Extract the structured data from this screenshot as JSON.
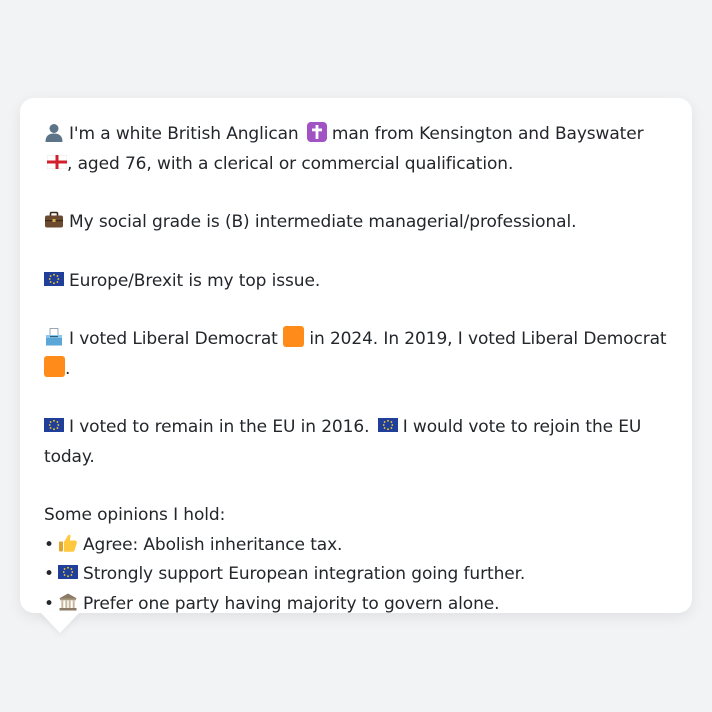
{
  "persona": {
    "identity": {
      "pre": "I'm a white British Anglican",
      "mid": "man from Kensington and Bayswater",
      "post": ", aged 76, with a clerical or commercial qualification."
    },
    "social_grade": "My social grade is (B) intermediate managerial/professional.",
    "top_issue": "Europe/Brexit is my top issue.",
    "votes": {
      "pre": "I voted Liberal Democrat",
      "mid": "in 2024. In 2019, I voted Liberal Democrat",
      "post": "."
    },
    "eu": {
      "first": "I voted to remain in the EU in 2016.",
      "second": "I would vote to rejoin the EU today."
    },
    "opinions_heading": "Some opinions I hold:",
    "opinions": [
      {
        "bullet": "•",
        "icon": "thumbs-up-icon",
        "text": "Agree: Abolish inheritance tax."
      },
      {
        "bullet": "•",
        "icon": "eu-flag-icon",
        "text": "Strongly support European integration going further."
      },
      {
        "bullet": "•",
        "icon": "government-building-icon",
        "text": "Prefer one party having majority to govern alone."
      }
    ]
  },
  "colors": {
    "background": "#f2f3f5",
    "card": "#ffffff",
    "text": "#23262b",
    "libdem_orange": "#ff8c1a",
    "eu_blue": "#1f3f9a",
    "eu_star": "#ffd21f"
  }
}
